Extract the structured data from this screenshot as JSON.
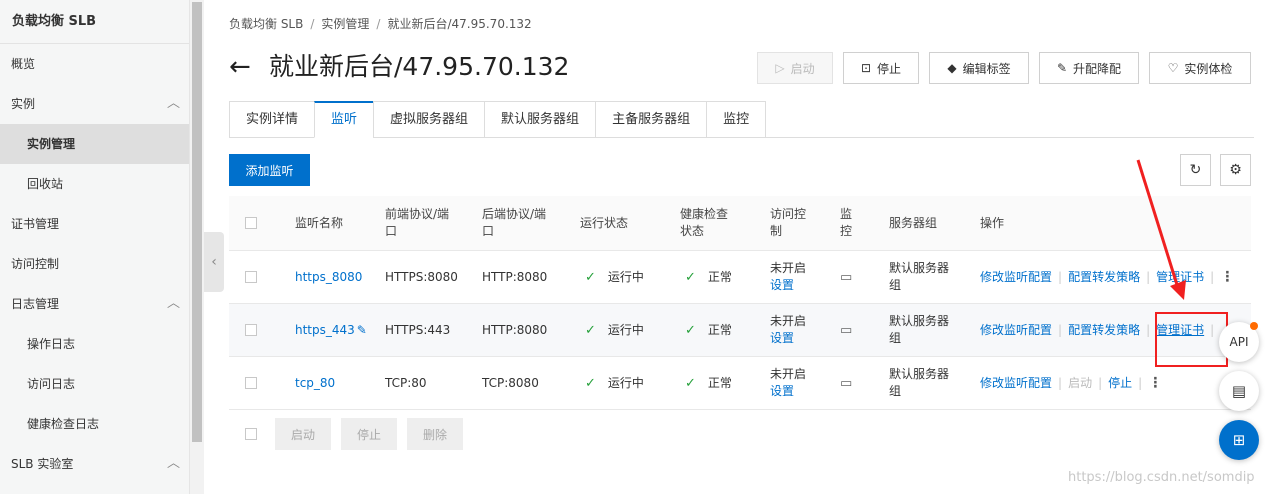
{
  "sidebar": {
    "brand": "负载均衡 SLB",
    "items": [
      {
        "label": "概览"
      },
      {
        "label": "实例"
      },
      {
        "label": "实例管理"
      },
      {
        "label": "回收站"
      },
      {
        "label": "证书管理"
      },
      {
        "label": "访问控制"
      },
      {
        "label": "日志管理"
      },
      {
        "label": "操作日志"
      },
      {
        "label": "访问日志"
      },
      {
        "label": "健康检查日志"
      },
      {
        "label": "SLB 实验室"
      }
    ]
  },
  "breadcrumb": [
    "负载均衡 SLB",
    "实例管理",
    "就业新后台/47.95.70.132"
  ],
  "header": {
    "title": "就业新后台/47.95.70.132",
    "buttons": {
      "start": "启动",
      "stop": "停止",
      "edit_tags": "编辑标签",
      "upgrade": "升配降配",
      "health_check": "实例体检"
    }
  },
  "tabs": [
    "实例详情",
    "监听",
    "虚拟服务器组",
    "默认服务器组",
    "主备服务器组",
    "监控"
  ],
  "toolbar": {
    "add_listener": "添加监听"
  },
  "table": {
    "headers": {
      "name": "监听名称",
      "frontend": "前端协议/端口",
      "backend": "后端协议/端口",
      "status": "运行状态",
      "health": "健康检查状态",
      "acl": "访问控制",
      "monitor": "监控",
      "server_group": "服务器组",
      "ops": "操作"
    },
    "rows": [
      {
        "name": "https_8080",
        "frontend": "HTTPS:8080",
        "backend": "HTTP:8080",
        "status": "运行中",
        "health": "正常",
        "acl": "未开启",
        "acl_link": "设置",
        "server_group": "默认服务器组",
        "op1": "修改监听配置",
        "op2": "配置转发策略",
        "op3": "管理证书"
      },
      {
        "name": "https_443",
        "frontend": "HTTPS:443",
        "backend": "HTTP:8080",
        "status": "运行中",
        "health": "正常",
        "acl": "未开启",
        "acl_link": "设置",
        "server_group": "默认服务器组",
        "op1": "修改监听配置",
        "op2": "配置转发策略",
        "op3": "管理证书"
      },
      {
        "name": "tcp_80",
        "frontend": "TCP:80",
        "backend": "TCP:8080",
        "status": "运行中",
        "health": "正常",
        "acl": "未开启",
        "acl_link": "设置",
        "server_group": "默认服务器组",
        "op1": "修改监听配置",
        "op2": "启动",
        "op3": "停止"
      }
    ]
  },
  "bulk": {
    "start": "启动",
    "stop": "停止",
    "delete": "删除"
  },
  "float": {
    "api": "API"
  },
  "watermark": "https://blog.csdn.net/somdip",
  "colors": {
    "accent": "#0070cc",
    "annotation": "#f02020",
    "ok": "#25a03a"
  }
}
